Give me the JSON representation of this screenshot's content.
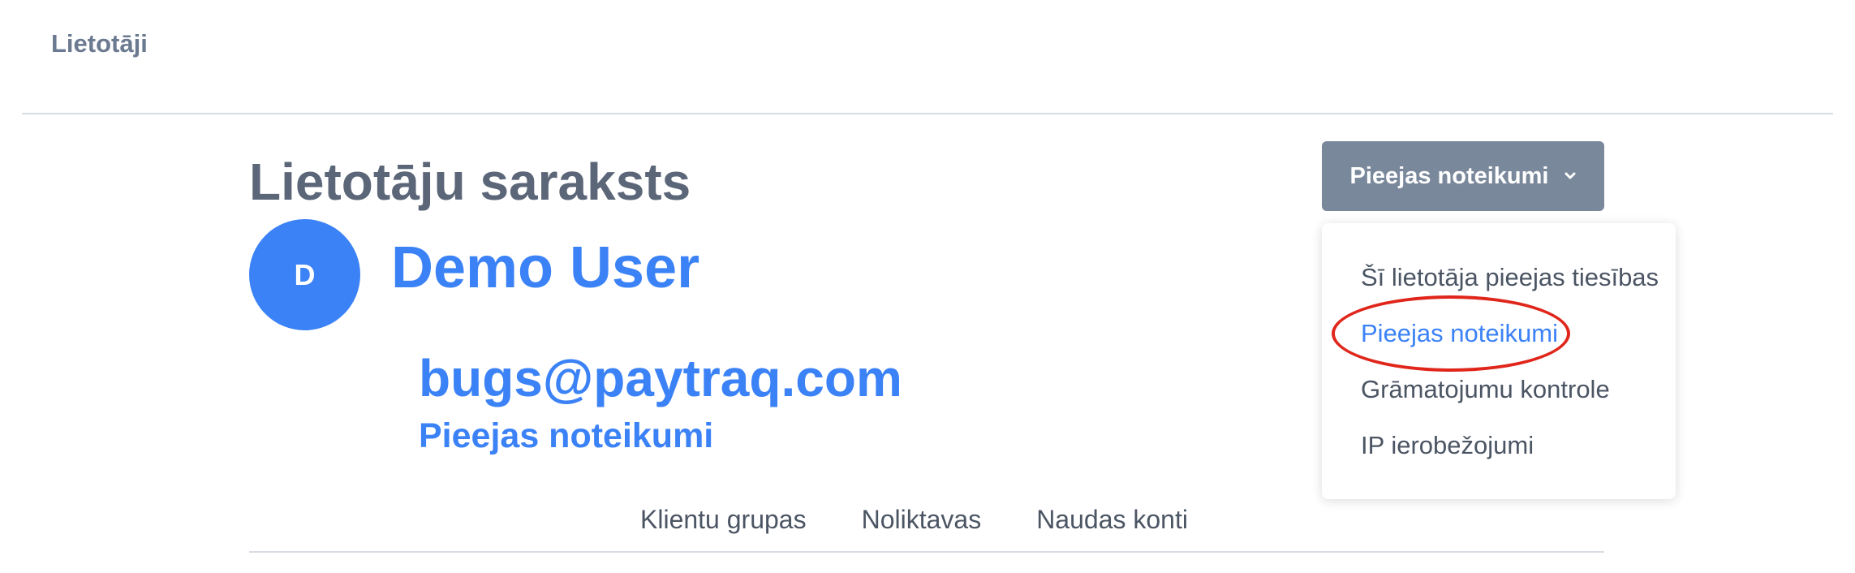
{
  "header": {
    "breadcrumb": "Lietotāji"
  },
  "main": {
    "title": "Lietotāju saraksts",
    "user": {
      "avatar_letter": "D",
      "name": "Demo User",
      "email": "bugs@paytraq.com"
    },
    "section_title": "Pieejas noteikumi",
    "tabs": [
      {
        "label": "Klientu grupas"
      },
      {
        "label": "Noliktavas"
      },
      {
        "label": "Naudas konti"
      }
    ]
  },
  "dropdown": {
    "button_label": "Pieejas noteikumi",
    "button_icon": "chevron-down-icon",
    "items": [
      {
        "label": "Šī lietotāja pieejas tiesības",
        "active": false
      },
      {
        "label": "Pieejas noteikumi",
        "active": true
      },
      {
        "label": "Grāmatojumu kontrole",
        "active": false
      },
      {
        "label": "IP ierobežojumi",
        "active": false
      }
    ]
  },
  "colors": {
    "accent": "#3b82f6",
    "button_bg": "#7a889b",
    "annotation": "#e0261b"
  }
}
